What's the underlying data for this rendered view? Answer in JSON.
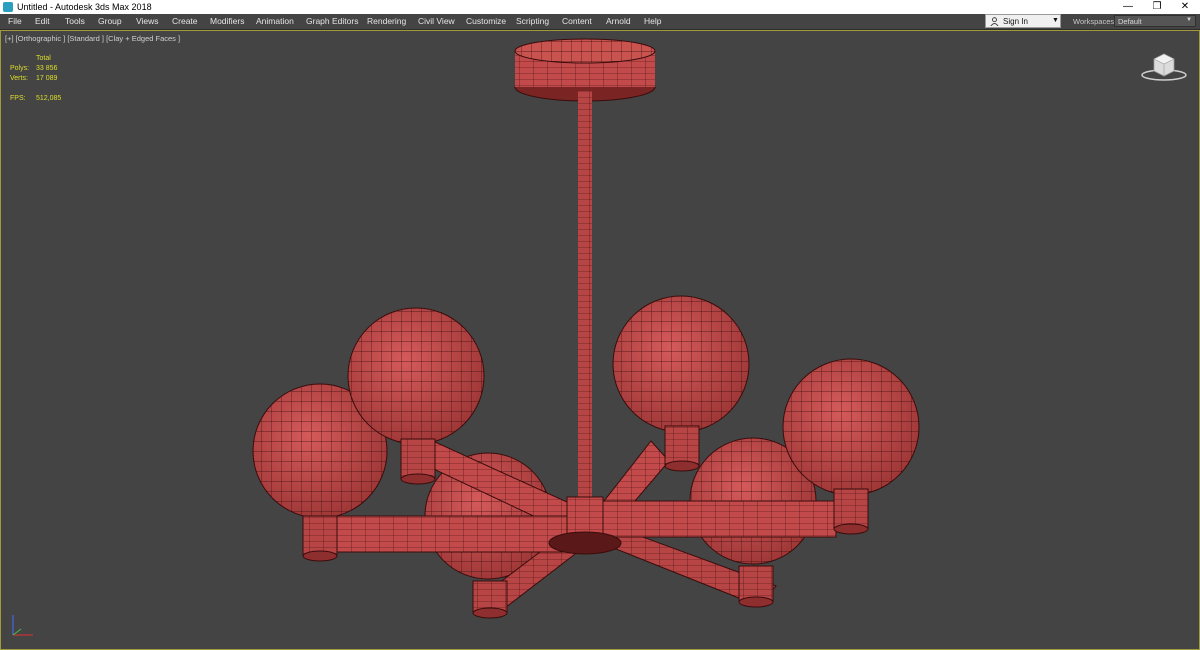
{
  "window": {
    "title": "Untitled - Autodesk 3ds Max 2018"
  },
  "window_controls": {
    "minimize": "—",
    "maximize": "❐",
    "close": "✕"
  },
  "menu": [
    "File",
    "Edit",
    "Tools",
    "Group",
    "Views",
    "Create",
    "Modifiers",
    "Animation",
    "Graph Editors",
    "Rendering",
    "Civil View",
    "Customize",
    "Scripting",
    "Content",
    "Arnold",
    "Help"
  ],
  "signin": {
    "label": "Sign In",
    "caret": "▼"
  },
  "workspaces": {
    "label": "Workspaces:",
    "value": "Default",
    "caret": "▼"
  },
  "viewport": {
    "label": "[+] [Orthographic ] [Standard ] [Clay + Edged Faces ]",
    "stats": {
      "header": "Total",
      "polys_label": "Polys:",
      "polys_value": "33 856",
      "verts_label": "Verts:",
      "verts_value": "17 089",
      "fps_label": "FPS:",
      "fps_value": "512,085"
    }
  },
  "colors": {
    "clay": "#c24a4a",
    "clay_dark": "#8e2e2e",
    "wire": "#3a0c0c",
    "viewport_bg": "#444444",
    "viewport_border": "#a29a3a",
    "stats_text": "#dede2a"
  },
  "icons": [
    "app-icon",
    "user-icon",
    "viewcube-icon",
    "axis-gizmo-icon"
  ]
}
